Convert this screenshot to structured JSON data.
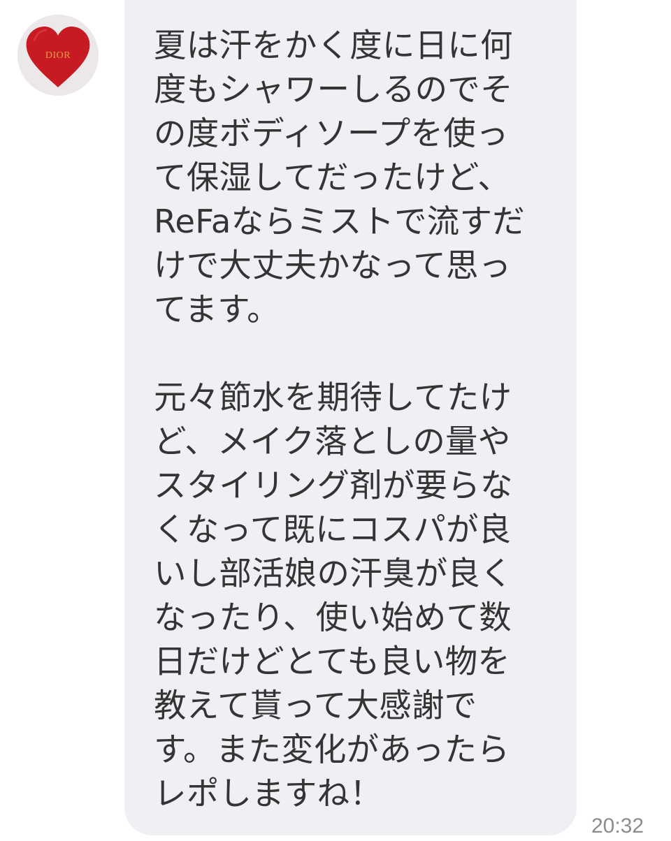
{
  "contact": {
    "avatar_logo_text": "DIOR",
    "avatar_icon": "red-heart-dior-logo"
  },
  "message": {
    "paragraphs": [
      [
        "夏は汗をかく度に日に何",
        "度もシャワーしるのでそ",
        "の度ボディソープを使っ",
        "て保湿してだったけど、",
        "ReFaならミストで流すだ",
        "けで大丈夫かなって思っ",
        "てます。"
      ],
      [
        "元々節水を期待してたけ",
        "ど、メイク落としの量や",
        "スタイリング剤が要らな",
        "くなって既にコスパが良",
        "いし部活娘の汗臭が良く",
        "なったり、使い始めて数",
        "日だけどとても良い物を",
        "教えて貰って大感謝で",
        "す。また変化があったら",
        "レポしますね！"
      ]
    ],
    "timestamp": "20:32"
  },
  "colors": {
    "bubble": "#eef0f4",
    "text": "#343434",
    "timestamp": "#8a8c8f",
    "heart": "#c81a22",
    "logo_gold": "#d9a441"
  }
}
